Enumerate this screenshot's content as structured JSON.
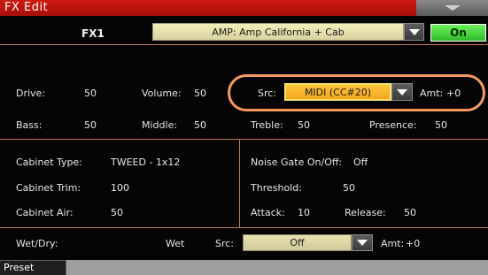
{
  "title": "FX Edit",
  "header": {
    "fx_label": "FX1",
    "amp_model": "AMP: Amp California + Cab",
    "on_label": "On"
  },
  "amp_params": {
    "drive_label": "Drive:",
    "drive_value": "50",
    "volume_label": "Volume:",
    "volume_value": "50",
    "bass_label": "Bass:",
    "bass_value": "50",
    "middle_label": "Middle:",
    "middle_value": "50",
    "treble_label": "Treble:",
    "treble_value": "50",
    "presence_label": "Presence:",
    "presence_value": "50"
  },
  "modulation": {
    "src_label": "Src:",
    "src_value": "MIDI (CC#20)",
    "amt_label": "Amt:",
    "amt_value": "+0"
  },
  "cabinet": {
    "type_label": "Cabinet Type:",
    "type_value": "TWEED - 1x12",
    "trim_label": "Cabinet Trim:",
    "trim_value": "100",
    "air_label": "Cabinet Air:",
    "air_value": "50"
  },
  "noise_gate": {
    "onoff_label": "Noise Gate On/Off:",
    "onoff_value": "Off",
    "threshold_label": "Threshold:",
    "threshold_value": "50",
    "attack_label": "Attack:",
    "attack_value": "10",
    "release_label": "Release:",
    "release_value": "50"
  },
  "wetdry": {
    "label": "Wet/Dry:",
    "value": "Wet",
    "src_label": "Src:",
    "src_value": "Off",
    "amt_label": "Amt:",
    "amt_value": "+0"
  },
  "footer": {
    "preset_tab": "Preset"
  },
  "colors": {
    "title_red": "#c4140e",
    "on_green": "#4fd842",
    "src_orange": "#f7b12b",
    "highlight_ring": "#f49a5f",
    "divider": "#c17a57"
  }
}
